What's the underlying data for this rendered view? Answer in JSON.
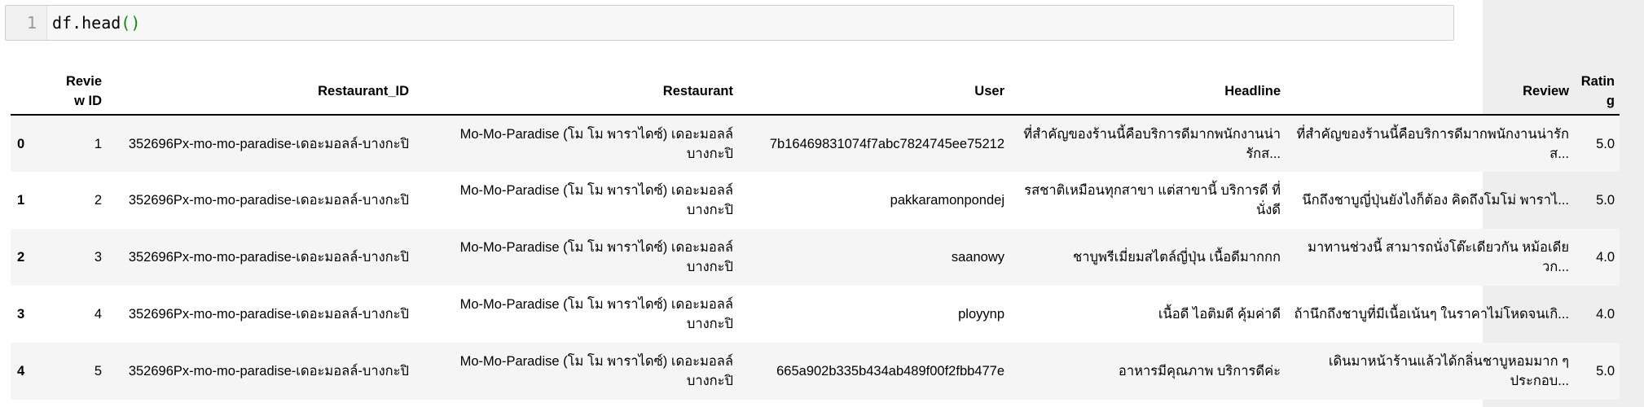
{
  "cell": {
    "line_number": "1",
    "code_prefix": "df.head",
    "code_parens": "()"
  },
  "table": {
    "columns": [
      "Review ID",
      "Restaurant_ID",
      "Restaurant",
      "User",
      "Headline",
      "Review",
      "Rating"
    ],
    "rows": [
      {
        "index": "0",
        "cells": [
          "1",
          "352696Px-mo-mo-paradise-เดอะมอลล์-บางกะปิ",
          "Mo-Mo-Paradise (โม โม พาราไดซ์) เดอะมอลล์ บางกะปิ",
          "7b16469831074f7abc7824745ee75212",
          "ที่สำคัญของร้านนี้คือบริการดีมากพนักงานน่ารักส...",
          "ที่สำคัญของร้านนี้คือบริการดีมากพนักงานน่ารักส...",
          "5.0"
        ]
      },
      {
        "index": "1",
        "cells": [
          "2",
          "352696Px-mo-mo-paradise-เดอะมอลล์-บางกะปิ",
          "Mo-Mo-Paradise (โม โม พาราไดซ์) เดอะมอลล์ บางกะปิ",
          "pakkaramonpondej",
          "รสชาติเหมือนทุกสาขา แต่สาขานี้ บริการดี ที่นั่งดี",
          "นึกถึงชาบูญี่ปุ่นยังไงก็ต้อง คิดถึงโมโม่ พาราไ...",
          "5.0"
        ]
      },
      {
        "index": "2",
        "cells": [
          "3",
          "352696Px-mo-mo-paradise-เดอะมอลล์-บางกะปิ",
          "Mo-Mo-Paradise (โม โม พาราไดซ์) เดอะมอลล์ บางกะปิ",
          "saanowy",
          "ชาบูพรีเมี่ยมสไตล์ญี่ปุ่น เนื้อดีมากกก",
          "มาทานช่วงนี้ สามารถนั่งโต๊ะเดียวกัน หม้อเดียวก...",
          "4.0"
        ]
      },
      {
        "index": "3",
        "cells": [
          "4",
          "352696Px-mo-mo-paradise-เดอะมอลล์-บางกะปิ",
          "Mo-Mo-Paradise (โม โม พาราไดซ์) เดอะมอลล์ บางกะปิ",
          "ployynp",
          "เนื้อดี ไอติมดี คุ้มค่าดี",
          "ถ้านึกถึงชาบูที่มีเนื้อเน้นๆ ในราคาไม่โหดจนเกิ...",
          "4.0"
        ]
      },
      {
        "index": "4",
        "cells": [
          "5",
          "352696Px-mo-mo-paradise-เดอะมอลล์-บางกะปิ",
          "Mo-Mo-Paradise (โม โม พาราไดซ์) เดอะมอลล์ บางกะปิ",
          "665a902b335b434ab489f00f2fbb477e",
          "อาหารมีคุณภาพ บริการดีค่ะ",
          "เดินมาหน้าร้านแล้วได้กลิ่นชาบูหอมมาก ๆ ประกอบ...",
          "5.0"
        ]
      }
    ]
  }
}
